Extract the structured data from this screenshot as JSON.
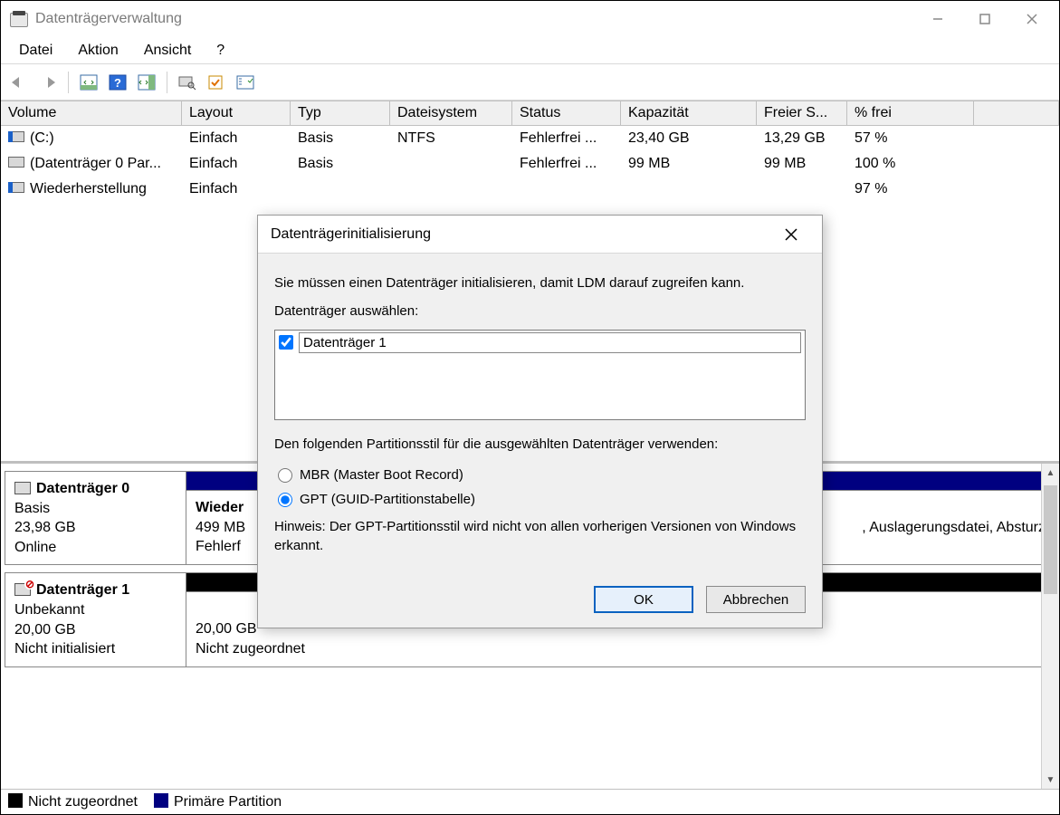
{
  "title": "Datenträgerverwaltung",
  "menu": [
    "Datei",
    "Aktion",
    "Ansicht",
    "?"
  ],
  "columns": [
    "Volume",
    "Layout",
    "Typ",
    "Dateisystem",
    "Status",
    "Kapazität",
    "Freier S...",
    "% frei"
  ],
  "volumes": [
    {
      "name": "(C:)",
      "layout": "Einfach",
      "type": "Basis",
      "fs": "NTFS",
      "status": "Fehlerfrei ...",
      "cap": "23,40 GB",
      "free": "13,29 GB",
      "pct": "57 %"
    },
    {
      "name": "(Datenträger 0 Par...",
      "layout": "Einfach",
      "type": "Basis",
      "fs": "",
      "status": "Fehlerfrei ...",
      "cap": "99 MB",
      "free": "99 MB",
      "pct": "100 %"
    },
    {
      "name": "Wiederherstellung",
      "layout": "Einfach",
      "type": "",
      "fs": "",
      "status": "",
      "cap": "",
      "free": "",
      "pct": "97 %"
    }
  ],
  "disk0": {
    "name": "Datenträger 0",
    "type": "Basis",
    "size": "23,98 GB",
    "status": "Online",
    "part_name": "Wieder",
    "part_size": "499 MB",
    "part_status": "Fehlerf",
    "right": ", Auslagerungsdatei, Absturz"
  },
  "disk1": {
    "name": "Datenträger 1",
    "type": "Unbekannt",
    "size": "20,00 GB",
    "status": "Nicht initialisiert",
    "part_size": "20,00 GB",
    "part_status": "Nicht zugeordnet"
  },
  "legend": {
    "unalloc": "Nicht zugeordnet",
    "primary": "Primäre Partition"
  },
  "dialog": {
    "title": "Datenträgerinitialisierung",
    "intro": "Sie müssen einen Datenträger initialisieren, damit LDM darauf zugreifen kann.",
    "select_label": "Datenträger auswählen:",
    "item": "Datenträger 1",
    "style_label": "Den folgenden Partitionsstil für die ausgewählten Datenträger verwenden:",
    "mbr": "MBR (Master Boot Record)",
    "gpt": "GPT (GUID-Partitionstabelle)",
    "hint": "Hinweis: Der GPT-Partitionsstil wird nicht von allen vorherigen Versionen von Windows erkannt.",
    "ok": "OK",
    "cancel": "Abbrechen"
  }
}
